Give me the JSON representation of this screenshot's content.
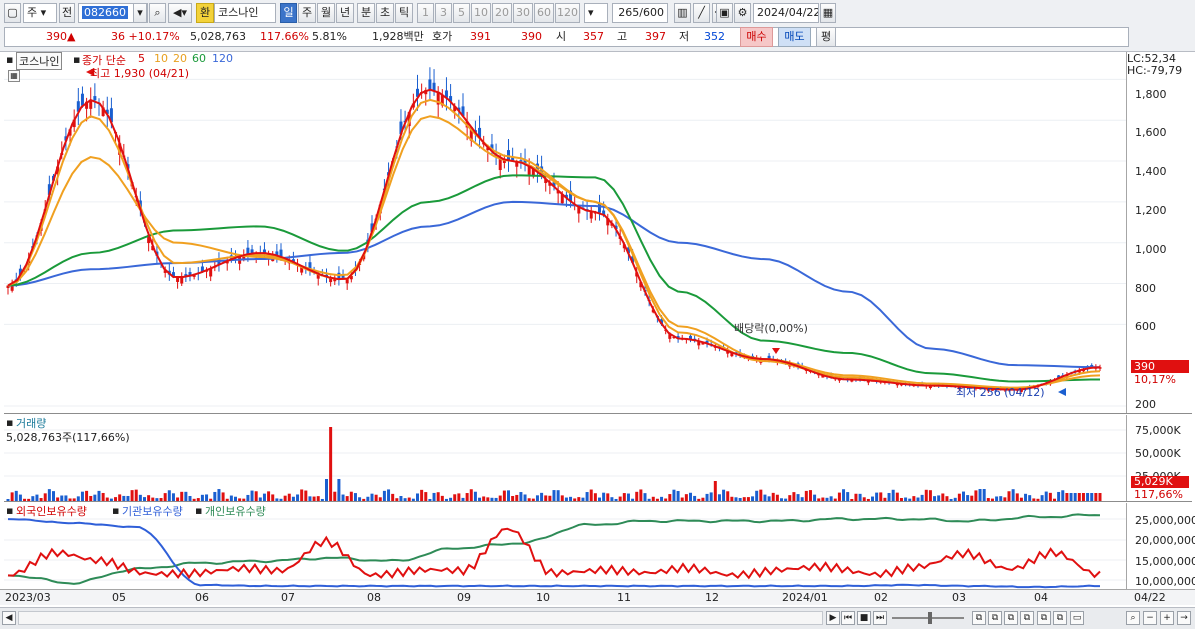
{
  "toolbar": {
    "type_label": "주",
    "prev_label": "전",
    "code": "082660",
    "currency_label": "환",
    "stock_name": "코스나인",
    "periods": [
      "일",
      "주",
      "월",
      "년",
      "분",
      "초",
      "틱"
    ],
    "minutes": [
      "1",
      "3",
      "5",
      "10",
      "20",
      "30",
      "60",
      "120"
    ],
    "count": "265",
    "count_total": "/600",
    "date": "2024/04/22"
  },
  "quote": {
    "price": "390",
    "arrow": "▲",
    "change": "36 +10.17%",
    "volume": "5,028,763",
    "volume_pct": "117.66%",
    "turnover": "5.81%",
    "amount": "1,928백만",
    "hoga_label": "호가",
    "ask": "391",
    "bid": "390",
    "open_label": "시",
    "open": "357",
    "high_label": "고",
    "high": "397",
    "low_label": "저",
    "low": "352",
    "buy_label": "매수",
    "sell_label": "매도",
    "eval_label": "평"
  },
  "price_panel": {
    "legend_name": "코스나인",
    "legend_ma": "종가 단순",
    "ma_periods": [
      "5",
      "10",
      "20",
      "60",
      "120"
    ],
    "max_note": "최고 1,930 (04/21)",
    "min_note": "최저 256 (04/12)",
    "dividend_note": "배당락(0,00%)",
    "lc": "LC:52,34",
    "hc": "HC:-79,79",
    "y_ticks": [
      "1,800",
      "1,600",
      "1,400",
      "1,200",
      "1,000",
      "800",
      "600",
      "200"
    ],
    "last_price": "390",
    "last_change": "10,17%"
  },
  "volume_panel": {
    "title": "거래량",
    "value": "5,028,763주(117,66%)",
    "y_ticks": [
      "75,000K",
      "50,000K",
      "25,000K"
    ],
    "last_value": "5,029K",
    "last_pct": "117,66%"
  },
  "holding_panel": {
    "legend": [
      "외국인보유수량",
      "기관보유수량",
      "개인보유수량"
    ],
    "y_ticks": [
      "25,000,000",
      "20,000,000",
      "15,000,000",
      "10,000,000"
    ]
  },
  "x_axis": [
    "2023/03",
    "05",
    "06",
    "07",
    "08",
    "09",
    "10",
    "11",
    "12",
    "2024/01",
    "02",
    "03",
    "04",
    "04/22"
  ],
  "colors": {
    "up": "#e01010",
    "down": "#1a5fd0",
    "ma5": "#e01010",
    "ma10": "#f0a020",
    "ma20": "#f0a020",
    "ma60": "#1a9a3a",
    "ma120": "#3a68d8",
    "foreign": "#e01010",
    "institution": "#2f5fd8",
    "individual": "#2e8b57"
  },
  "chart_data": {
    "type": "line",
    "title": "코스나인",
    "ylim": [
      200,
      1900
    ],
    "x": [
      "2023/03",
      "05",
      "06",
      "07",
      "08",
      "09",
      "10",
      "11",
      "12",
      "2024/01",
      "02",
      "03",
      "04",
      "04/22"
    ],
    "series": [
      {
        "name": "5",
        "values": [
          790,
          1700,
          830,
          950,
          820,
          1750,
          1400,
          1150,
          530,
          430,
          330,
          300,
          280,
          390
        ]
      },
      {
        "name": "10",
        "values": [
          790,
          1620,
          900,
          940,
          820,
          1700,
          1420,
          1200,
          560,
          420,
          340,
          300,
          285,
          370
        ]
      },
      {
        "name": "20",
        "values": [
          790,
          1420,
          1000,
          930,
          840,
          1620,
          1400,
          1200,
          590,
          430,
          350,
          310,
          290,
          350
        ]
      },
      {
        "name": "60",
        "values": [
          790,
          950,
          1060,
          1080,
          960,
          1200,
          1330,
          1320,
          760,
          520,
          460,
          360,
          320,
          330
        ]
      },
      {
        "name": "120",
        "values": [
          790,
          870,
          900,
          920,
          950,
          1080,
          1200,
          1180,
          1000,
          920,
          760,
          480,
          400,
          390
        ]
      }
    ]
  }
}
